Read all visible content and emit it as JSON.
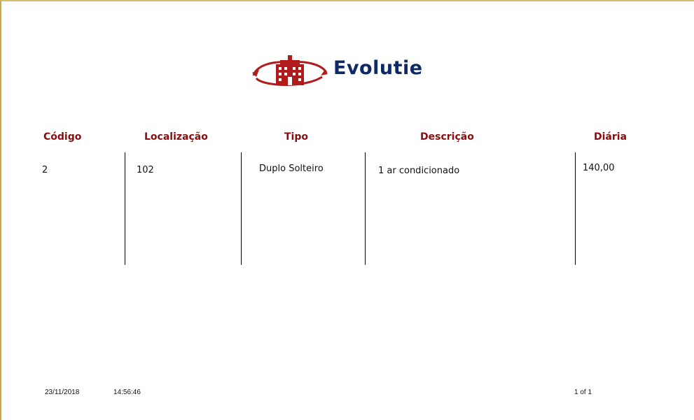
{
  "report": {
    "logo_text": "Evolutie",
    "brand_color": "#0e2a66",
    "header_color": "#8b0c0c",
    "logo_color": "#b21b1b",
    "columns": {
      "codigo": "Código",
      "localizacao": "Localização",
      "tipo": "Tipo",
      "descricao": "Descrição",
      "diaria": "Diária"
    },
    "rows": [
      {
        "codigo": "2",
        "localizacao": "102",
        "tipo": "Duplo Solteiro",
        "descricao": "1 ar condicionado",
        "diaria": "140,00"
      }
    ],
    "footer": {
      "date": "23/11/2018",
      "time": "14:56:46",
      "page": "1 of 1"
    }
  }
}
